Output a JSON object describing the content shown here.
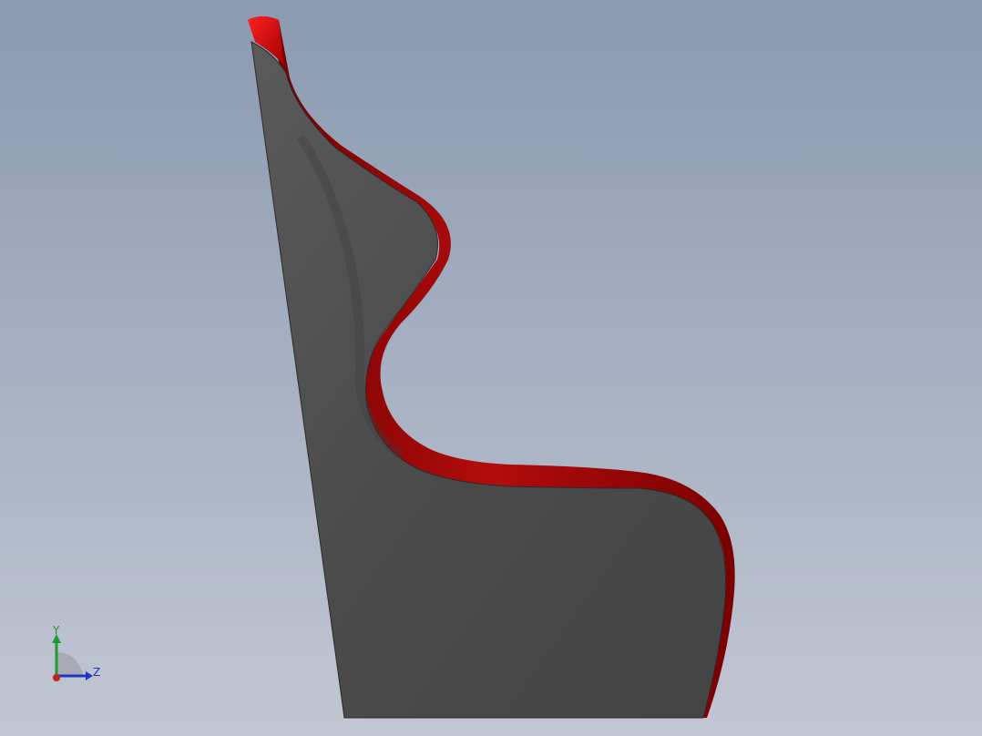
{
  "viewport": {
    "background_top": "#8a9ab0",
    "background_bottom": "#c2c6d2"
  },
  "model": {
    "body_color": "#4b4b4b",
    "edge_color": "#b00000",
    "edge_dark_color": "#5a0000"
  },
  "triad": {
    "y_label": "Y",
    "z_label": "Z",
    "y_color": "#1f9a2f",
    "z_color": "#1f33c8",
    "x_color": "#c0202a",
    "y_icon": "y-axis-arrow-icon",
    "z_icon": "z-axis-arrow-icon",
    "origin_icon": "origin-point-icon"
  }
}
